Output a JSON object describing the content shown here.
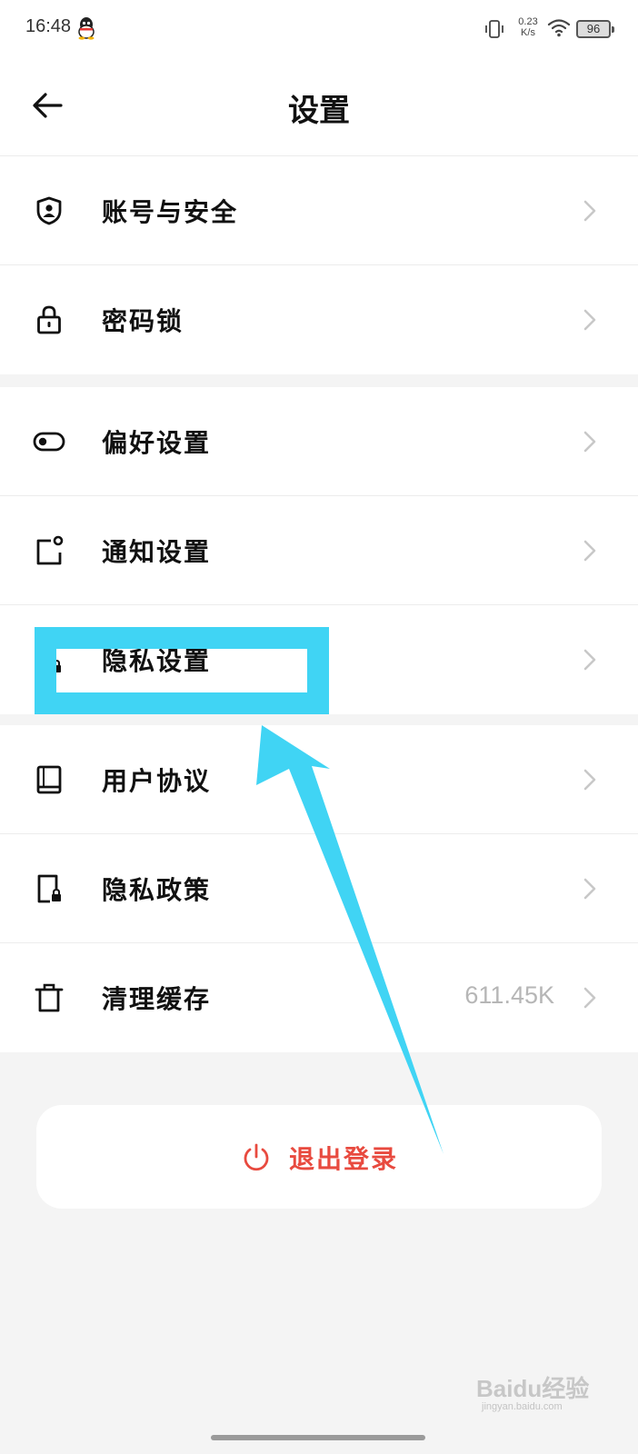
{
  "status_bar": {
    "time": "16:48",
    "net_speed_value": "0.23",
    "net_speed_unit": "K/s",
    "battery": "96"
  },
  "header": {
    "title": "设置"
  },
  "groups": [
    {
      "items": [
        {
          "label": "账号与安全",
          "icon": "shield-user-icon"
        },
        {
          "label": "密码锁",
          "icon": "lock-icon"
        }
      ]
    },
    {
      "items": [
        {
          "label": "偏好设置",
          "icon": "toggle-icon"
        },
        {
          "label": "通知设置",
          "icon": "notification-icon"
        },
        {
          "label": "隐私设置",
          "icon": "privacy-person-lock-icon"
        }
      ]
    },
    {
      "items": [
        {
          "label": "用户协议",
          "icon": "book-icon"
        },
        {
          "label": "隐私政策",
          "icon": "document-lock-icon"
        },
        {
          "label": "清理缓存",
          "icon": "trash-icon",
          "value": "611.45K"
        }
      ]
    }
  ],
  "logout": {
    "label": "退出登录",
    "icon": "power-icon",
    "color": "#e84a3f"
  },
  "annotation": {
    "highlight_color": "#40d4f4",
    "highlighted_item": "隐私设置"
  },
  "watermark": {
    "text": "Baidu经验",
    "url": "jingyan.baidu.com"
  }
}
